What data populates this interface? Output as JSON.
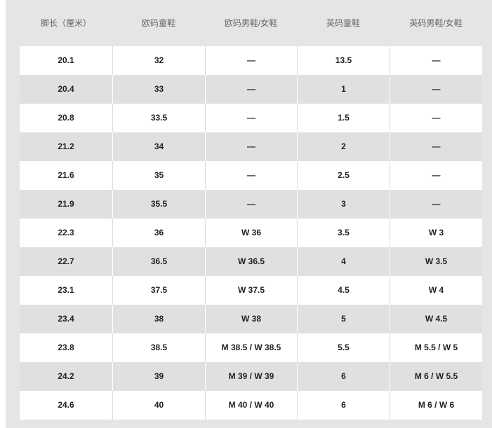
{
  "headers": [
    "脚长（厘米）",
    "欧码童鞋",
    "欧码男鞋/女鞋",
    "英码童鞋",
    "英码男鞋/女鞋"
  ],
  "rows": [
    [
      "20.1",
      "32",
      "—",
      "13.5",
      "—"
    ],
    [
      "20.4",
      "33",
      "—",
      "1",
      "—"
    ],
    [
      "20.8",
      "33.5",
      "—",
      "1.5",
      "—"
    ],
    [
      "21.2",
      "34",
      "—",
      "2",
      "—"
    ],
    [
      "21.6",
      "35",
      "—",
      "2.5",
      "—"
    ],
    [
      "21.9",
      "35.5",
      "—",
      "3",
      "—"
    ],
    [
      "22.3",
      "36",
      "W 36",
      "3.5",
      "W 3"
    ],
    [
      "22.7",
      "36.5",
      "W 36.5",
      "4",
      "W 3.5"
    ],
    [
      "23.1",
      "37.5",
      "W 37.5",
      "4.5",
      "W 4"
    ],
    [
      "23.4",
      "38",
      "W 38",
      "5",
      "W 4.5"
    ],
    [
      "23.8",
      "38.5",
      "M 38.5 / W 38.5",
      "5.5",
      "M 5.5 / W 5"
    ],
    [
      "24.2",
      "39",
      "M 39 / W 39",
      "6",
      "M 6 / W 5.5"
    ],
    [
      "24.6",
      "40",
      "M 40 / W 40",
      "6",
      "M 6 / W 6"
    ]
  ]
}
